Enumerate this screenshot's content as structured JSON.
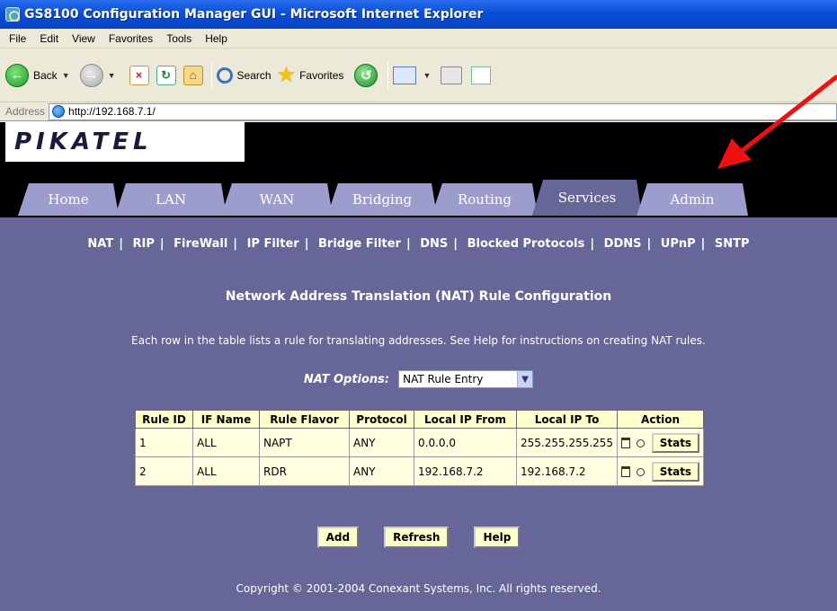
{
  "window": {
    "title": "GS8100 Configuration Manager GUI - Microsoft Internet Explorer"
  },
  "menu": [
    "File",
    "Edit",
    "View",
    "Favorites",
    "Tools",
    "Help"
  ],
  "toolbar": {
    "back": "Back",
    "search": "Search",
    "favorites": "Favorites"
  },
  "address": {
    "label": "Address",
    "url": "http://192.168.7.1/"
  },
  "brand": {
    "logo": "PIKATEL"
  },
  "tabs": [
    "Home",
    "LAN",
    "WAN",
    "Bridging",
    "Routing",
    "Services",
    "Admin"
  ],
  "active_tab": "Services",
  "subnav": [
    "NAT",
    "RIP",
    "FireWall",
    "IP Filter",
    "Bridge Filter",
    "DNS",
    "Blocked Protocols",
    "DDNS",
    "UPnP",
    "SNTP"
  ],
  "content": {
    "title": "Network Address Translation (NAT) Rule Configuration",
    "description": "Each row in the table lists a rule for translating addresses. See Help for instructions on creating NAT rules.",
    "options_label": "NAT Options:",
    "options_value": "NAT Rule Entry"
  },
  "table": {
    "headers": [
      "Rule ID",
      "IF Name",
      "Rule Flavor",
      "Protocol",
      "Local IP From",
      "Local IP To",
      "Action"
    ],
    "rows": [
      [
        "1",
        "ALL",
        "NAPT",
        "ANY",
        "0.0.0.0",
        "255.255.255.255"
      ],
      [
        "2",
        "ALL",
        "RDR",
        "ANY",
        "192.168.7.2",
        "192.168.7.2"
      ]
    ],
    "stats_label": "Stats"
  },
  "buttons": {
    "add": "Add",
    "refresh": "Refresh",
    "help": "Help"
  },
  "footer": "Copyright © 2001-2004 Conexant Systems, Inc. All rights reserved."
}
